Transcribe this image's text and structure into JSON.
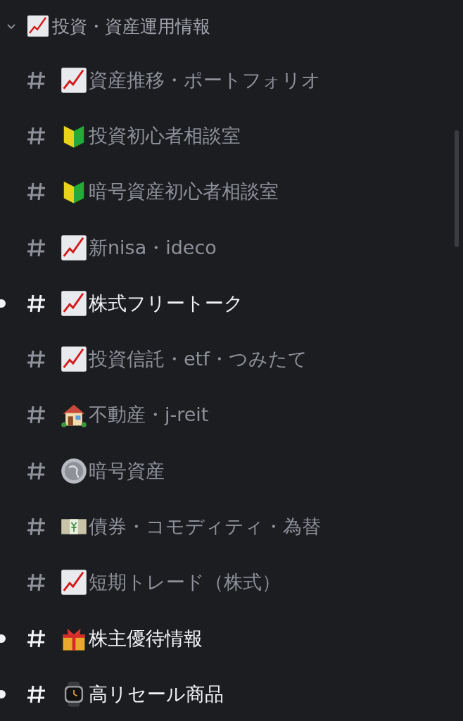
{
  "category": {
    "name": "投資・資産運用情報",
    "kind": "chart",
    "expanded": true
  },
  "channels": [
    {
      "name": "資産推移・ポートフォリオ",
      "kind": "chart",
      "unread": false
    },
    {
      "name": "投資初心者相談室",
      "kind": "beginner",
      "unread": false
    },
    {
      "name": "暗号資産初心者相談室",
      "kind": "beginner",
      "unread": false
    },
    {
      "name": "新nisa・ideco",
      "kind": "chart",
      "unread": false
    },
    {
      "name": "株式フリートーク",
      "kind": "chart",
      "unread": true
    },
    {
      "name": "投資信託・etf・つみたて",
      "kind": "chart",
      "unread": false
    },
    {
      "name": "不動産・j-reit",
      "kind": "house",
      "unread": false
    },
    {
      "name": "暗号資産",
      "kind": "coin",
      "unread": false
    },
    {
      "name": "債券・コモディティ・為替",
      "kind": "banknote",
      "unread": false
    },
    {
      "name": "短期トレード（株式）",
      "kind": "chart",
      "unread": false
    },
    {
      "name": "株主優待情報",
      "kind": "gift",
      "unread": true
    },
    {
      "name": "高リセール商品",
      "kind": "watch",
      "unread": true
    }
  ]
}
